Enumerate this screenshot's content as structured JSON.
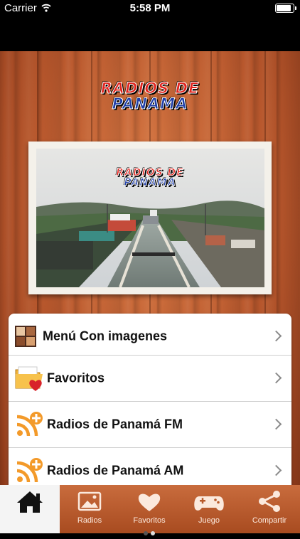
{
  "status_bar": {
    "carrier": "Carrier",
    "time": "5:58 PM"
  },
  "logo": {
    "line1": "RADIOS DE",
    "line2": "PANAMA"
  },
  "photo_logo": {
    "line1": "RADIOS DE",
    "line2": "PANAMA"
  },
  "menu": {
    "items": [
      {
        "label": "Menú Con imagenes",
        "icon": "grid-icon"
      },
      {
        "label": "Favoritos",
        "icon": "folder-heart-icon"
      },
      {
        "label": "Radios de Panamá FM",
        "icon": "rss-add-icon"
      },
      {
        "label": "Radios de Panamá AM",
        "icon": "rss-add-icon"
      }
    ]
  },
  "tabbar": {
    "tabs": [
      {
        "label": "",
        "icon": "home-icon",
        "active": true
      },
      {
        "label": "Radios",
        "icon": "image-icon"
      },
      {
        "label": "Favoritos",
        "icon": "heart-icon"
      },
      {
        "label": "Juego",
        "icon": "gamepad-icon"
      },
      {
        "label": "Compartir",
        "icon": "share-icon"
      }
    ]
  },
  "colors": {
    "wood": "#b9582d",
    "tabbar": "#b85a2b",
    "accent_orange": "#f39a2a",
    "logo_red": "#e0241e",
    "logo_blue": "#1f3fa8"
  }
}
